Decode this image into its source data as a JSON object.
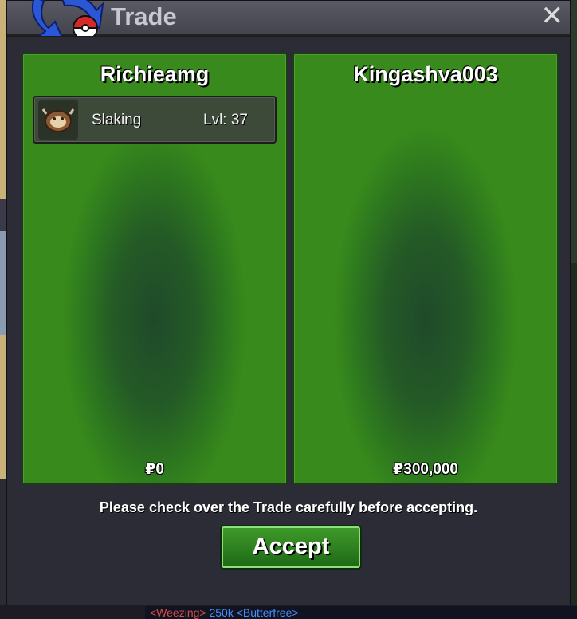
{
  "window": {
    "title": "Trade",
    "close_label": "✕"
  },
  "left_panel": {
    "player_name": "Richieamg",
    "money": "₽0",
    "pokemon": [
      {
        "name": "Slaking",
        "level": "Lvl: 37"
      }
    ]
  },
  "right_panel": {
    "player_name": "Kingashva003",
    "money": "₽300,000"
  },
  "notice": "Please check over the Trade carefully before accepting.",
  "accept_label": "Accept",
  "background_chat": {
    "part1": "<Weezing> ",
    "part2": "250k <Butterfree>"
  },
  "colors": {
    "panel_green": "#2e7a1e",
    "accept_green": "#3f9a2a",
    "window_bg": "#2c2c36"
  }
}
